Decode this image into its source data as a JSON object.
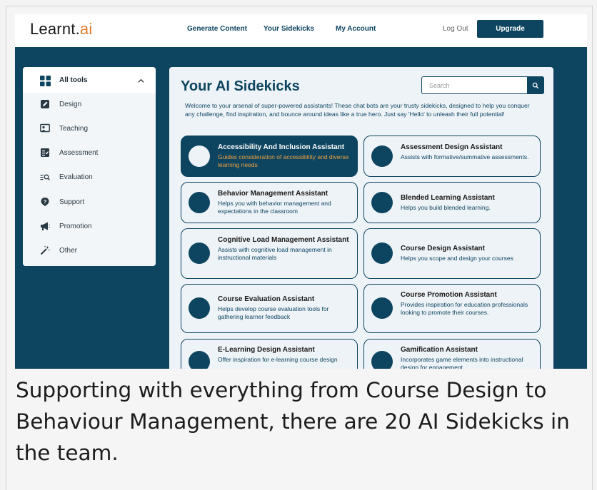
{
  "topbar": {
    "logo_main": "Learnt.",
    "logo_accent": "ai",
    "nav": [
      "Generate Content",
      "Your Sidekicks",
      "My Account"
    ],
    "logout": "Log Out",
    "upgrade": "Upgrade"
  },
  "sidebar": {
    "header": "All tools",
    "items": [
      {
        "label": "Design",
        "icon": "pencil-icon"
      },
      {
        "label": "Teaching",
        "icon": "teacher-board-icon"
      },
      {
        "label": "Assessment",
        "icon": "checklist-icon"
      },
      {
        "label": "Evaluation",
        "icon": "list-search-icon"
      },
      {
        "label": "Support",
        "icon": "help-icon"
      },
      {
        "label": "Promotion",
        "icon": "megaphone-icon"
      },
      {
        "label": "Other",
        "icon": "magic-wand-icon"
      }
    ]
  },
  "main": {
    "title": "Your AI Sidekicks",
    "search_placeholder": "Search",
    "intro": "Welcome to your arsenal of super-powered assistants! These chat bots are your trusty sidekicks, designed to help you conquer any challenge, find inspiration, and bounce around ideas like a true hero. Just say 'Hello' to unleash their full potential!",
    "cards": [
      {
        "name": "Accessibility And Inclusion Assistant",
        "desc": "Guides consideration of accessibility and diverse learning needs",
        "active": true
      },
      {
        "name": "Assessment Design Assistant",
        "desc": "Assists with formative/summative assessments."
      },
      {
        "name": "Behavior Management Assistant",
        "desc": "Helps you with behavior management and expectations in the classroom"
      },
      {
        "name": "Blended Learning Assistant",
        "desc": "Helps you build blended learning."
      },
      {
        "name": "Cognitive Load Management Assistant",
        "desc": "Assists with cognitive load management in instructional materials"
      },
      {
        "name": "Course Design Assistant",
        "desc": "Helps you scope and design your courses"
      },
      {
        "name": "Course Evaluation Assistant",
        "desc": "Helps develop course evaluation tools for gathering learner feedback"
      },
      {
        "name": "Course Promotion Assistant",
        "desc": "Provides inspiration for education professionals looking to promote their courses."
      },
      {
        "name": "E-Learning Design Assistant",
        "desc": "Offer inspiration for e-learning course design"
      },
      {
        "name": "Gamification Assistant",
        "desc": "Incorporates game elements into instructional design for engagement"
      }
    ]
  },
  "caption": "Supporting with everything from Course Design to Behaviour Management, there are 20 AI Sidekicks in the team.",
  "colors": {
    "brand": "#0d4560",
    "accent": "#e07d2b",
    "active_desc": "#f0a040"
  }
}
